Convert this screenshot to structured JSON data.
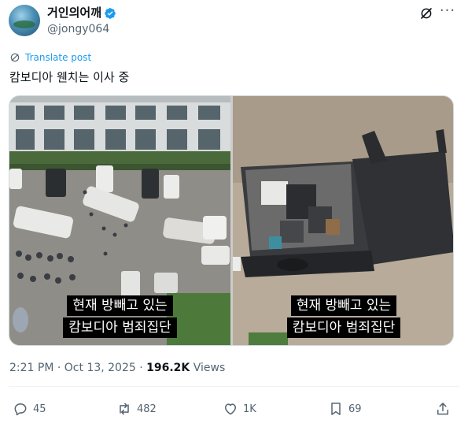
{
  "author": {
    "display_name": "거인의어깨",
    "handle": "@jongy064"
  },
  "translate_label": "Translate post",
  "text": "캄보디아 웬치는 이사 중",
  "media": {
    "caption_line1": "현재 방빼고 있는",
    "caption_line2": "캄보디아 범죄집단"
  },
  "meta": {
    "time": "2:21 PM",
    "separator": "·",
    "date": "Oct 13, 2025",
    "views_count": "196.2K",
    "views_label": "Views"
  },
  "actions": {
    "replies": "45",
    "reposts": "482",
    "likes": "1K",
    "bookmarks": "69"
  },
  "icons": [
    "verified-badge-icon",
    "grok-icon",
    "more-icon",
    "translate-icon",
    "reply-icon",
    "repost-icon",
    "like-icon",
    "bookmark-icon",
    "share-icon"
  ],
  "colors": {
    "accent": "#1d9bf0",
    "text": "#0f1419",
    "secondary": "#536471"
  }
}
